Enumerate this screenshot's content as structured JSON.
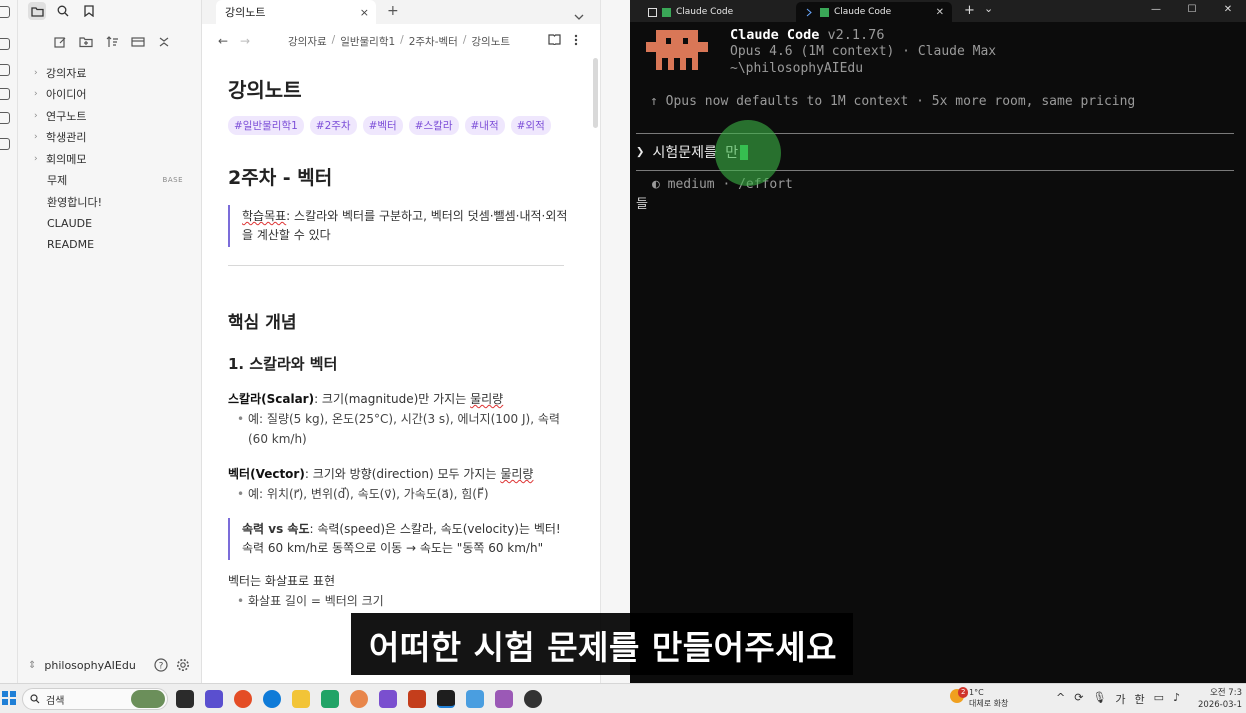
{
  "explorer": {
    "folders": [
      {
        "label": "강의자료"
      },
      {
        "label": "아이디어"
      },
      {
        "label": "연구노트"
      },
      {
        "label": "학생관리"
      },
      {
        "label": "회의메모"
      }
    ],
    "files": [
      {
        "label": "무제",
        "badge": "BASE"
      },
      {
        "label": "환영합니다!"
      },
      {
        "label": "CLAUDE"
      },
      {
        "label": "README"
      }
    ],
    "vault_name": "philosophyAIEdu"
  },
  "note_tab": {
    "title": "강의노트",
    "close": "×",
    "add": "+"
  },
  "breadcrumb": [
    "강의자료",
    "일반물리학1",
    "2주차-벡터",
    "강의노트"
  ],
  "note": {
    "title": "강의노트",
    "tags": [
      "#일반물리학1",
      "#2주차",
      "#벡터",
      "#스칼라",
      "#내적",
      "#외적"
    ],
    "h2": "2주차 - 벡터",
    "goal_label": "학습목표",
    "goal_text": ": 스칼라와 벡터를 구분하고, 벡터의 덧셈·뺄셈·내적·외적을 계산할 수 있다",
    "h3": "핵심 개념",
    "h4": "1. 스칼라와 벡터",
    "scalar_term": "스칼라(Scalar)",
    "scalar_def": ": 크기(magnitude)만 가지는 ",
    "scalar_word": "물리량",
    "scalar_ex": "예: 질량(5 kg), 온도(25°C), 시간(3 s), 에너지(100 J), 속력(60 km/h)",
    "vector_term": "벡터(Vector)",
    "vector_def": ": 크기와 방향(direction) 모두 가지는 ",
    "vector_word": "물리량",
    "vector_ex": "예: 위치(r⃗), 변위(d⃗), 속도(v⃗), 가속도(a⃗), 힘(F⃗)",
    "speed_term": "속력 vs 속도",
    "speed_text": ": 속력(speed)은 스칼라, 속도(velocity)는 벡터! 속력 60 km/h로 동쪽으로 이동 → 속도는 \"동쪽 60 km/h\"",
    "arrow_para": "벡터는 화살표로 표현",
    "arrow_bullet": "화살표 길이 = 벡터의 크기"
  },
  "terminal": {
    "tabs": [
      {
        "label": "Claude Code"
      },
      {
        "label": "Claude Code"
      }
    ],
    "tab_add": "+",
    "tab_dropdown": "⌄",
    "product_name": "Claude Code",
    "version": "v2.1.76",
    "model_line": "Opus 4.6 (1M context) · Claude Max",
    "path": "~\\philosophyAIEdu",
    "notice": "↑ Opus now defaults to 1M context · 5x more room, same pricing",
    "prompt_caret": "❯",
    "prompt_text": "시험문제를 만",
    "effort_line": "◐ medium · /effort",
    "leftover": "들"
  },
  "subtitle": "어떠한 시험 문제를 만들어주세요",
  "taskbar": {
    "search_placeholder": "검색",
    "weather_temp": "1°C",
    "weather_desc": "대체로 화창",
    "weather_badge": "2",
    "tray_lang": "가",
    "tray_ime": "한",
    "time": "오전 7:3",
    "date": "2026-03-1"
  }
}
